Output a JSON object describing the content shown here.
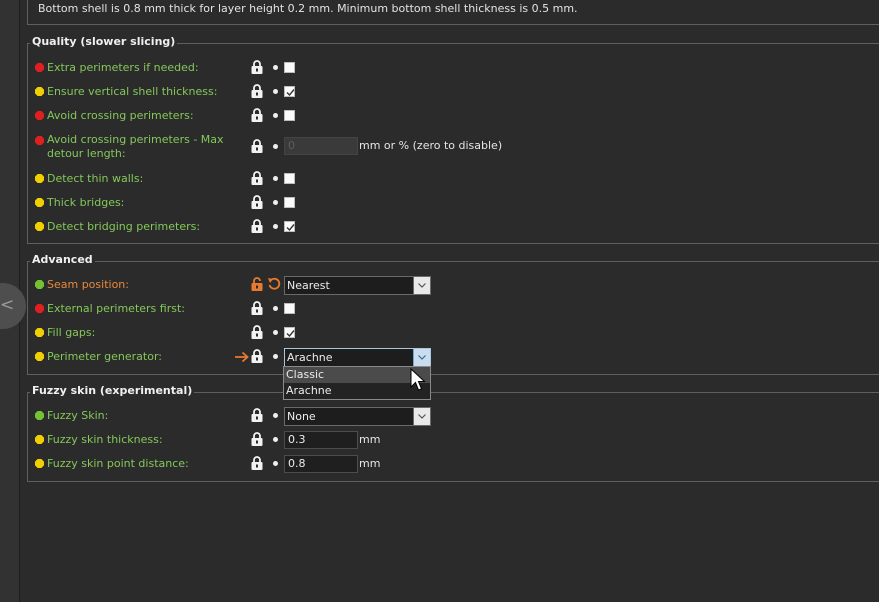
{
  "top_note": "Bottom shell is 0.8 mm thick for layer height 0.2 mm. Minimum bottom shell thickness is 0.5 mm.",
  "colors": {
    "red_dot": "#e02020",
    "yellow_dot": "#f0d000",
    "green_dot": "#74c234",
    "label_green": "#84c85a",
    "label_orange": "#e8893e",
    "lock_orange": "#e87a30"
  },
  "quality": {
    "title": "Quality (slower slicing)",
    "rows": [
      {
        "label": "Extra perimeters if needed:",
        "dot": "red",
        "checked": false
      },
      {
        "label": "Ensure vertical shell thickness:",
        "dot": "yellow",
        "checked": true
      },
      {
        "label": "Avoid crossing perimeters:",
        "dot": "red",
        "checked": false
      },
      {
        "label_line1": "Avoid crossing perimeters - Max",
        "label_line2": "detour length:",
        "dot": "red",
        "value": "0",
        "unit": "mm or % (zero to disable)"
      },
      {
        "label": "Detect thin walls:",
        "dot": "yellow",
        "checked": false
      },
      {
        "label": "Thick bridges:",
        "dot": "yellow",
        "checked": false
      },
      {
        "label": "Detect bridging perimeters:",
        "dot": "yellow",
        "checked": true
      }
    ]
  },
  "advanced": {
    "title": "Advanced",
    "rows": [
      {
        "label": "Seam position:",
        "dot": "green",
        "value": "Nearest",
        "modified": true
      },
      {
        "label": "External perimeters first:",
        "dot": "red",
        "checked": false
      },
      {
        "label": "Fill gaps:",
        "dot": "yellow",
        "checked": true
      },
      {
        "label": "Perimeter generator:",
        "dot": "yellow",
        "value": "Arachne",
        "arrow_icon": "right-arrow-icon"
      }
    ],
    "dropdown_options": [
      "Classic",
      "Arachne"
    ],
    "dropdown_hovered": "Classic"
  },
  "fuzzy": {
    "title": "Fuzzy skin (experimental)",
    "rows": [
      {
        "label": "Fuzzy Skin:",
        "dot": "green",
        "value": "None"
      },
      {
        "label": "Fuzzy skin thickness:",
        "dot": "yellow",
        "value": "0.3",
        "unit": "mm"
      },
      {
        "label": "Fuzzy skin point distance:",
        "dot": "yellow",
        "value": "0.8",
        "unit": "mm"
      }
    ]
  },
  "icons": {
    "lock": "lock-icon",
    "unlock": "unlock-icon",
    "undo": "undo-icon",
    "system_dot": "system-value-dot-icon",
    "check": "checkmark-icon",
    "chevron": "chevron-down-icon",
    "collapse": "chevron-left-icon",
    "cursor": "mouse-cursor-icon"
  },
  "sidebar": {
    "collapse_glyph": "<"
  }
}
